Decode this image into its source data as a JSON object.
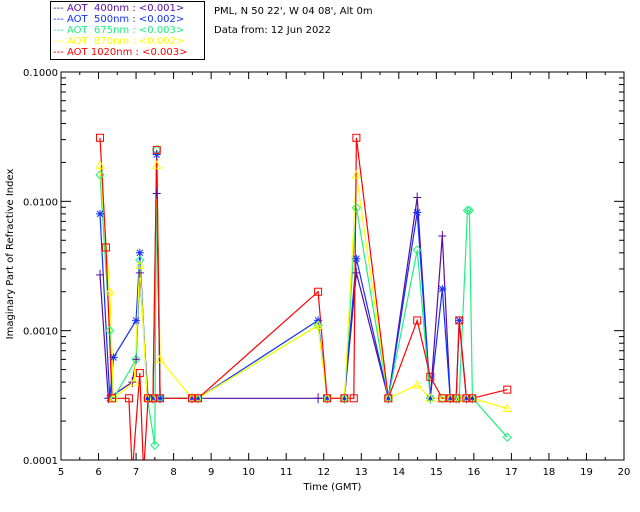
{
  "header": {
    "site": "PML, N 50 22', W 04 08', Alt 0m",
    "date": "Data from: 12 Jun 2022"
  },
  "chart_data": {
    "type": "line",
    "xlabel": "Time (GMT)",
    "ylabel": "Imaginary Part of Refractive Index",
    "xlim": [
      5,
      20
    ],
    "ylim": [
      0.0001,
      0.1
    ],
    "yscale": "log",
    "xticks": [
      "5",
      "6",
      "7",
      "8",
      "9",
      "10",
      "11",
      "12",
      "13",
      "14",
      "15",
      "16",
      "17",
      "18",
      "19",
      "20"
    ],
    "yticks": [
      "0.0001",
      "0.0010",
      "0.0100",
      "0.1000"
    ],
    "legend_position": "top-left-outside",
    "series": [
      {
        "name": "AOT  400nm : <0.001>",
        "color": "#5a0ca0",
        "marker": "plus",
        "points": [
          [
            6.04,
            0.0027
          ],
          [
            6.26,
            0.0003
          ],
          [
            6.9,
            0.0004
          ],
          [
            7.0,
            0.0006
          ],
          [
            7.1,
            0.0028
          ],
          [
            7.32,
            0.0003
          ],
          [
            7.45,
            0.0003
          ],
          [
            7.55,
            0.0115
          ],
          [
            7.64,
            0.0003
          ],
          [
            8.49,
            0.0003
          ],
          [
            8.65,
            0.0003
          ],
          [
            11.85,
            0.0003
          ],
          [
            12.09,
            0.0003
          ],
          [
            12.55,
            0.0003
          ],
          [
            12.87,
            0.0028
          ],
          [
            13.72,
            0.0003
          ],
          [
            14.49,
            0.0107
          ],
          [
            14.84,
            0.0003
          ],
          [
            15.16,
            0.0054
          ],
          [
            15.37,
            0.0003
          ],
          [
            15.53,
            0.0003
          ],
          [
            15.61,
            0.0003
          ],
          [
            15.8,
            0.0003
          ],
          [
            15.96,
            0.0003
          ]
        ]
      },
      {
        "name": "AOT  500nm : <0.002>",
        "color": "#1030ff",
        "marker": "star",
        "points": [
          [
            6.04,
            0.008
          ],
          [
            6.3,
            0.0003
          ],
          [
            6.4,
            0.00062
          ],
          [
            7.0,
            0.0012
          ],
          [
            7.1,
            0.004
          ],
          [
            7.3,
            0.0003
          ],
          [
            7.45,
            0.0003
          ],
          [
            7.55,
            0.023
          ],
          [
            7.64,
            0.0003
          ],
          [
            8.49,
            0.0003
          ],
          [
            8.65,
            0.0003
          ],
          [
            11.85,
            0.0012
          ],
          [
            12.09,
            0.0003
          ],
          [
            12.55,
            0.0003
          ],
          [
            12.87,
            0.0036
          ],
          [
            13.72,
            0.0003
          ],
          [
            14.49,
            0.0082
          ],
          [
            14.84,
            0.0003
          ],
          [
            15.16,
            0.0021
          ],
          [
            15.37,
            0.0003
          ],
          [
            15.53,
            0.0003
          ],
          [
            15.61,
            0.0012
          ],
          [
            15.8,
            0.0003
          ],
          [
            15.96,
            0.0003
          ]
        ]
      },
      {
        "name": "AOT  675nm : <0.003>",
        "color": "#20f080",
        "marker": "diamond",
        "points": [
          [
            6.04,
            0.016
          ],
          [
            6.3,
            0.001
          ],
          [
            6.4,
            0.0003
          ],
          [
            7.0,
            0.0006
          ],
          [
            7.1,
            0.0035
          ],
          [
            7.3,
            0.0003
          ],
          [
            7.5,
            0.00013
          ],
          [
            7.55,
            0.025
          ],
          [
            7.64,
            0.0003
          ],
          [
            8.49,
            0.0003
          ],
          [
            8.65,
            0.0003
          ],
          [
            11.85,
            0.0011
          ],
          [
            12.09,
            0.0003
          ],
          [
            12.55,
            0.0003
          ],
          [
            12.87,
            0.0089
          ],
          [
            13.72,
            0.0003
          ],
          [
            14.49,
            0.0042
          ],
          [
            14.84,
            0.0003
          ],
          [
            15.16,
            0.0003
          ],
          [
            15.37,
            0.0003
          ],
          [
            15.53,
            0.0003
          ],
          [
            15.61,
            0.0003
          ],
          [
            15.83,
            0.0085
          ],
          [
            15.88,
            0.0085
          ],
          [
            15.96,
            0.0003
          ],
          [
            16.89,
            0.00015
          ]
        ]
      },
      {
        "name": "AOT  870nm : <0.002>",
        "color": "#ffff00",
        "marker": "triangle",
        "points": [
          [
            6.04,
            0.019
          ],
          [
            6.3,
            0.002
          ],
          [
            6.4,
            0.0003
          ],
          [
            6.95,
            0.0004
          ],
          [
            7.1,
            0.0032
          ],
          [
            7.3,
            0.0003
          ],
          [
            7.45,
            0.0003
          ],
          [
            7.55,
            0.019
          ],
          [
            7.64,
            0.0006
          ],
          [
            8.49,
            0.0003
          ],
          [
            8.65,
            0.0003
          ],
          [
            11.85,
            0.0011
          ],
          [
            12.09,
            0.0003
          ],
          [
            12.55,
            0.0003
          ],
          [
            12.87,
            0.016
          ],
          [
            13.72,
            0.0003
          ],
          [
            14.49,
            0.00038
          ],
          [
            14.84,
            0.0003
          ],
          [
            15.16,
            0.0003
          ],
          [
            15.37,
            0.0003
          ],
          [
            15.53,
            0.0003
          ],
          [
            15.61,
            0.0003
          ],
          [
            15.8,
            0.0003
          ],
          [
            15.96,
            0.0003
          ],
          [
            16.89,
            0.00025
          ]
        ]
      },
      {
        "name": "AOT 1020nm : <0.003>",
        "color": "#ff0000",
        "marker": "square",
        "points": [
          [
            6.04,
            0.031
          ],
          [
            6.2,
            0.0044
          ],
          [
            6.36,
            0.0003
          ],
          [
            6.81,
            0.0003
          ],
          [
            6.9,
            8e-05
          ],
          [
            7.1,
            0.00047
          ],
          [
            7.2,
            8e-05
          ],
          [
            7.32,
            0.0003
          ],
          [
            7.45,
            0.0003
          ],
          [
            7.55,
            0.025
          ],
          [
            7.64,
            0.0003
          ],
          [
            8.49,
            0.0003
          ],
          [
            8.65,
            0.0003
          ],
          [
            11.85,
            0.002
          ],
          [
            12.09,
            0.0003
          ],
          [
            12.55,
            0.0003
          ],
          [
            12.8,
            0.0003
          ],
          [
            12.87,
            0.031
          ],
          [
            13.72,
            0.0003
          ],
          [
            14.49,
            0.0012
          ],
          [
            14.84,
            0.00044
          ],
          [
            15.16,
            0.0003
          ],
          [
            15.37,
            0.0003
          ],
          [
            15.53,
            0.0003
          ],
          [
            15.61,
            0.0012
          ],
          [
            15.8,
            0.0003
          ],
          [
            15.96,
            0.0003
          ],
          [
            16.89,
            0.00035
          ]
        ]
      }
    ]
  }
}
